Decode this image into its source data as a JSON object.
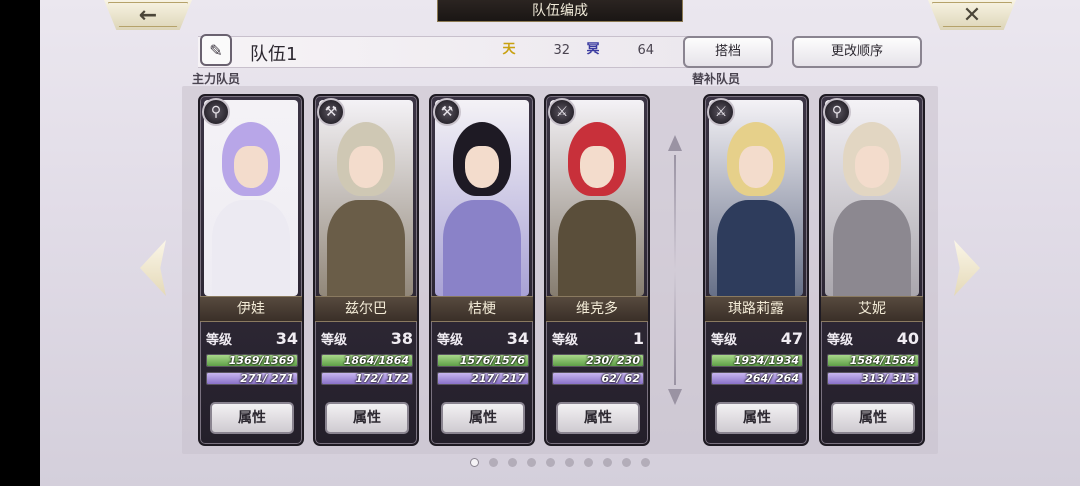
{
  "header": {
    "title": "队伍编成",
    "back_icon": "←",
    "close_icon": "✕"
  },
  "team": {
    "name": "队伍1",
    "sky_icon_text": "天",
    "sky_value": "32",
    "dark_icon_text": "冥",
    "dark_value": "64",
    "edit_icon": "✎"
  },
  "buttons": {
    "partner": "搭档",
    "change_order": "更改顺序"
  },
  "sections": {
    "main": "主力队员",
    "sub": "替补队员"
  },
  "labels": {
    "level": "等级",
    "attributes": "属性"
  },
  "members": [
    {
      "name": "伊娃",
      "level": "34",
      "hp": "1369/1369",
      "mp": "271/ 271",
      "hp_ratio": 1.0,
      "mp_ratio": 1.0,
      "icon": "staff-icon",
      "hair": "#b8a6e8",
      "body": "#eceaf2"
    },
    {
      "name": "兹尔巴",
      "level": "38",
      "hp": "1864/1864",
      "mp": "172/ 172",
      "hp_ratio": 1.0,
      "mp_ratio": 1.0,
      "icon": "axe-icon",
      "hair": "#cfc8b4",
      "body": "#6a5d48"
    },
    {
      "name": "桔梗",
      "level": "34",
      "hp": "1576/1576",
      "mp": "217/ 217",
      "hp_ratio": 1.0,
      "mp_ratio": 1.0,
      "icon": "axe-icon",
      "hair": "#1e1a24",
      "body": "#8a82c8"
    },
    {
      "name": "维克多",
      "level": "1",
      "hp": "230/ 230",
      "mp": "62/ 62",
      "hp_ratio": 1.0,
      "mp_ratio": 1.0,
      "icon": "sword-icon",
      "hair": "#c8303a",
      "body": "#5a4e3a"
    },
    {
      "name": "琪路莉露",
      "level": "47",
      "hp": "1934/1934",
      "mp": "264/ 264",
      "hp_ratio": 1.0,
      "mp_ratio": 1.0,
      "icon": "sword-icon",
      "hair": "#e6d08a",
      "body": "#2e3c5c"
    },
    {
      "name": "艾妮",
      "level": "40",
      "hp": "1584/1584",
      "mp": "313/ 313",
      "hp_ratio": 1.0,
      "mp_ratio": 1.0,
      "icon": "staff-icon",
      "hair": "#e2d6c2",
      "body": "#8c8890"
    }
  ],
  "pagination": {
    "total": 10,
    "active": 0
  }
}
